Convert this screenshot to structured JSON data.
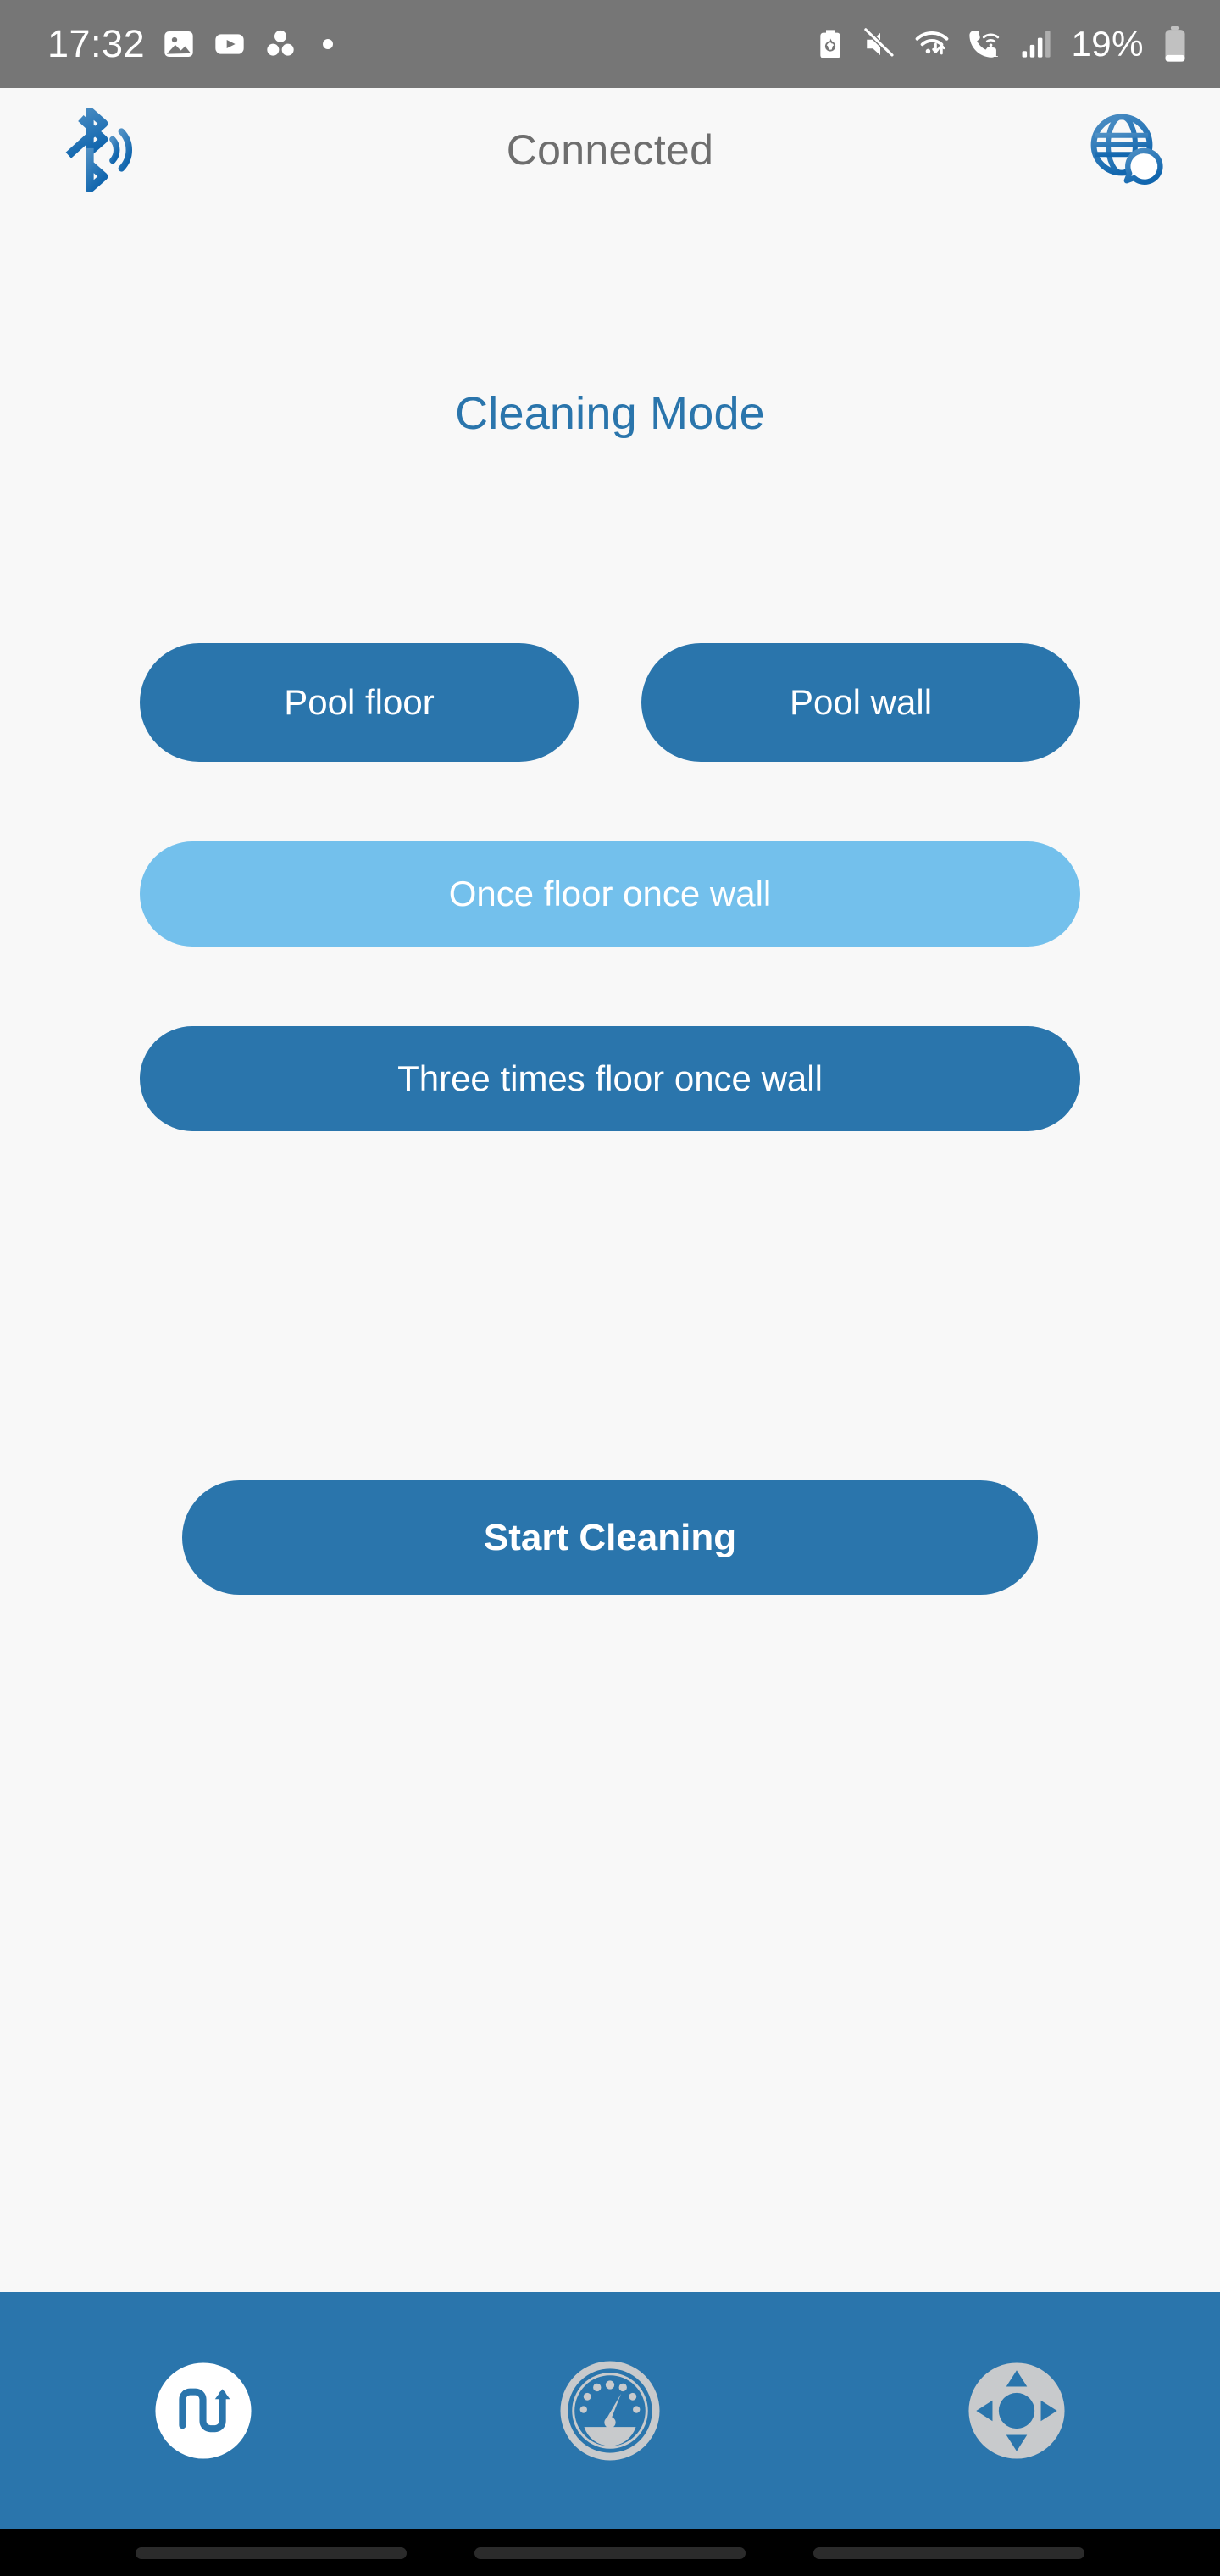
{
  "status_bar": {
    "time": "17:32",
    "battery_percent": "19%",
    "left_icons": [
      "photos-icon",
      "youtube-icon",
      "asana-icon",
      "dot-indicator-icon"
    ],
    "right_icons": [
      "battery-saver-icon",
      "mute-icon",
      "wifi-icon",
      "wifi-calling-icon",
      "cellular-signal-icon",
      "battery-icon"
    ],
    "background_color": "#767676"
  },
  "header": {
    "bluetooth_icon": "bluetooth-connected-icon",
    "title": "Connected",
    "language_icon": "globe-language-icon"
  },
  "main": {
    "page_title": "Cleaning Mode",
    "modes": [
      {
        "label": "Pool floor",
        "selected": false
      },
      {
        "label": "Pool wall",
        "selected": false
      },
      {
        "label": "Once floor once wall",
        "selected": true
      },
      {
        "label": "Three times floor once wall",
        "selected": false
      }
    ],
    "start_button": "Start Cleaning"
  },
  "bottom_nav": {
    "items": [
      {
        "icon": "cleaning-path-icon",
        "active": true
      },
      {
        "icon": "gauge-icon",
        "active": false
      },
      {
        "icon": "dpad-remote-icon",
        "active": false
      }
    ]
  },
  "colors": {
    "accent_blue": "#2A75AC",
    "selected_blue": "#73C0EC",
    "page_background": "#F8F8F8",
    "status_bar_gray": "#767676",
    "inactive_nav_icon": "#C8CACC"
  }
}
